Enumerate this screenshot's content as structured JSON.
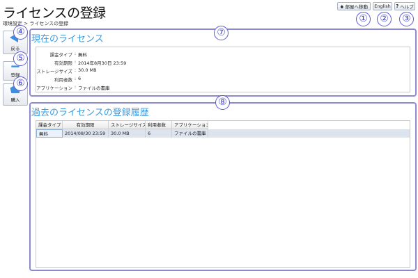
{
  "header": {
    "title": "ライセンスの登録",
    "breadcrumb": "環境設定 > ライセンスの登録"
  },
  "top_buttons": {
    "home": "部屋へ移動",
    "english": "English",
    "help": "ヘルプ"
  },
  "side_buttons": {
    "back": "戻る",
    "register": "登録",
    "purchase": "購入"
  },
  "markers": [
    "①",
    "②",
    "③",
    "④",
    "⑤",
    "⑥",
    "⑦",
    "⑧"
  ],
  "current_license": {
    "title": "現在のライセンス",
    "fields": [
      {
        "label": "課金タイプ",
        "value": "無料"
      },
      {
        "label": "有効期限",
        "value": "2014年8月30日 23:59"
      },
      {
        "label": "ストレージサイズ",
        "value": "30.0 MB"
      },
      {
        "label": "利用者数",
        "value": "6"
      },
      {
        "label": "アプリケーション",
        "value": "ファイルの書庫"
      }
    ]
  },
  "history": {
    "title": "過去のライセンスの登録履歴",
    "columns": [
      "課金タイプ",
      "有効期限",
      "ストレージサイズ",
      "利用者数",
      "アプリケーション"
    ],
    "rows": [
      [
        "無料",
        "2014/08/30 23:59",
        "30.0 MB",
        "6",
        "ファイルの書庫"
      ]
    ]
  },
  "colors": {
    "accent_title": "#3a9be0",
    "marker": "#4a4ac8",
    "panel_border": "#8a8ad4"
  }
}
